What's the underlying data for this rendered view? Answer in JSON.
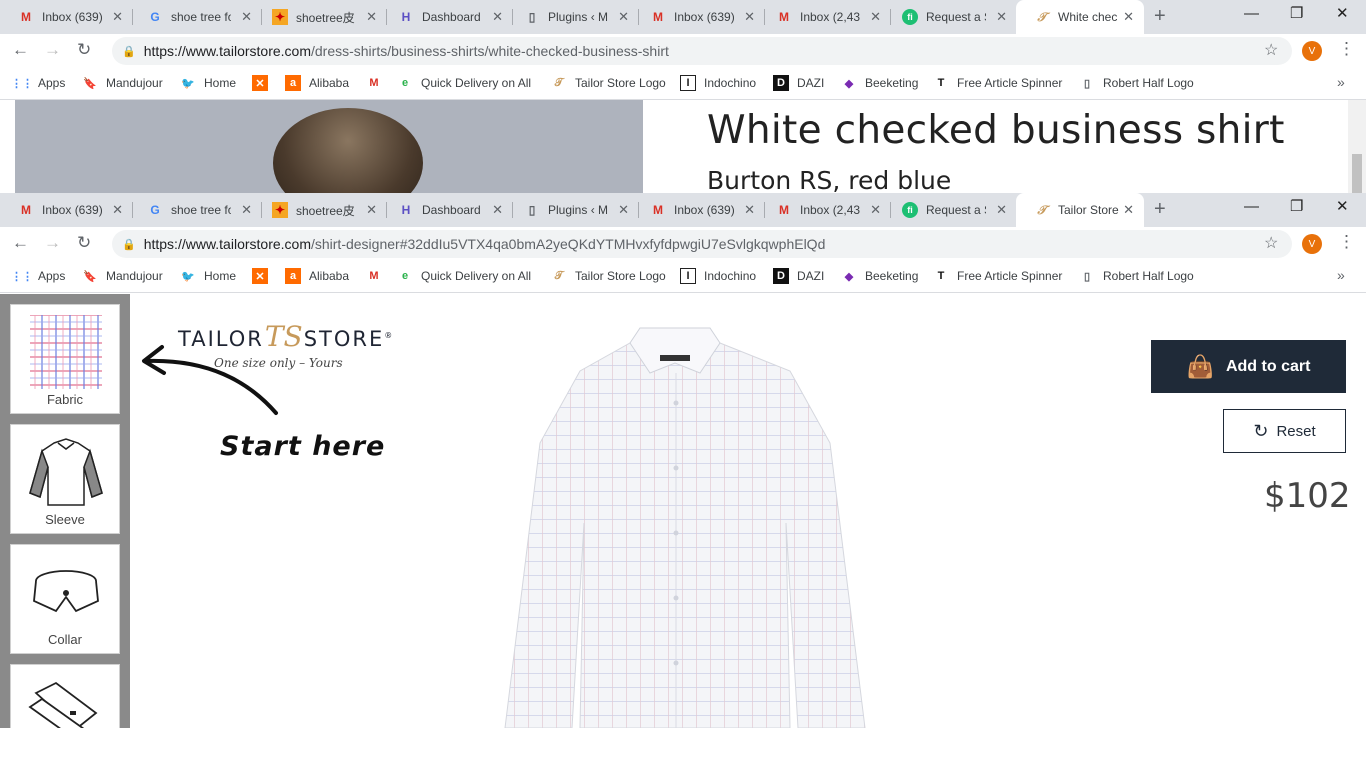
{
  "window1": {
    "tabs": [
      {
        "icon": "gmail-icon",
        "title": "Inbox (639)"
      },
      {
        "icon": "google-icon",
        "title": "shoe tree fo"
      },
      {
        "icon": "aliexpress-icon",
        "title": "shoetree皮"
      },
      {
        "icon": "dashboard-icon",
        "title": "Dashboard"
      },
      {
        "icon": "page-icon",
        "title": "Plugins ‹ M"
      },
      {
        "icon": "gmail-icon",
        "title": "Inbox (639)"
      },
      {
        "icon": "gmail-icon",
        "title": "Inbox (2,43("
      },
      {
        "icon": "fiverr-icon",
        "title": "Request a S"
      },
      {
        "icon": "tailorstore-icon",
        "title": "White chec"
      }
    ],
    "url": {
      "domain": "https://www.tailorstore.com",
      "path": "/dress-shirts/business-shirts/white-checked-business-shirt"
    },
    "product": {
      "title": "White checked business shirt",
      "subtitle": "Burton RS, red blue"
    }
  },
  "window2": {
    "tabs": [
      {
        "icon": "gmail-icon",
        "title": "Inbox (639)"
      },
      {
        "icon": "google-icon",
        "title": "shoe tree fo"
      },
      {
        "icon": "aliexpress-icon",
        "title": "shoetree皮"
      },
      {
        "icon": "dashboard-icon",
        "title": "Dashboard"
      },
      {
        "icon": "page-icon",
        "title": "Plugins ‹ M"
      },
      {
        "icon": "gmail-icon",
        "title": "Inbox (639)"
      },
      {
        "icon": "gmail-icon",
        "title": "Inbox (2,43("
      },
      {
        "icon": "fiverr-icon",
        "title": "Request a S"
      },
      {
        "icon": "tailorstore-icon",
        "title": "Tailor Store"
      }
    ],
    "url": {
      "domain": "https://www.tailorstore.com",
      "path": "/shirt-designer#32ddIu5VTX4qa0bmA2yeQKdYTMHvxfyfdpwgiU7eSvlgkqwphElQd"
    }
  },
  "profile_initial": "V",
  "bookmarks": [
    {
      "icon": "apps-icon",
      "label": "Apps"
    },
    {
      "icon": "bookmark-icon",
      "label": "Mandujour"
    },
    {
      "icon": "twitter-icon",
      "label": "Home"
    },
    {
      "icon": "alibaba-x-icon",
      "label": ""
    },
    {
      "icon": "alibaba-icon",
      "label": "Alibaba"
    },
    {
      "icon": "gmail-icon",
      "label": ""
    },
    {
      "icon": "e-icon",
      "label": "Quick Delivery on All"
    },
    {
      "icon": "tailorstore-icon",
      "label": "Tailor Store Logo"
    },
    {
      "icon": "indochino-icon",
      "label": "Indochino"
    },
    {
      "icon": "dazi-icon",
      "label": "DAZI"
    },
    {
      "icon": "beeketing-icon",
      "label": "Beeketing"
    },
    {
      "icon": "t-icon",
      "label": "Free Article Spinner"
    },
    {
      "icon": "page-icon",
      "label": "Robert Half Logo"
    }
  ],
  "designer": {
    "logo": {
      "left": "TAILOR",
      "monogram": "TS",
      "right": "STORE",
      "registered": "®"
    },
    "tagline": "One size only – Yours",
    "start_here": "Start here",
    "options": [
      {
        "label": "Fabric"
      },
      {
        "label": "Sleeve"
      },
      {
        "label": "Collar"
      },
      {
        "label": ""
      }
    ],
    "add_to_cart": "Add to cart",
    "reset": "Reset",
    "price": "$102"
  },
  "colors": {
    "navy": "#1f2a38",
    "gold": "#c79a5b",
    "tabstrip": "#dee1e6",
    "gmail_red": "#d93025"
  }
}
